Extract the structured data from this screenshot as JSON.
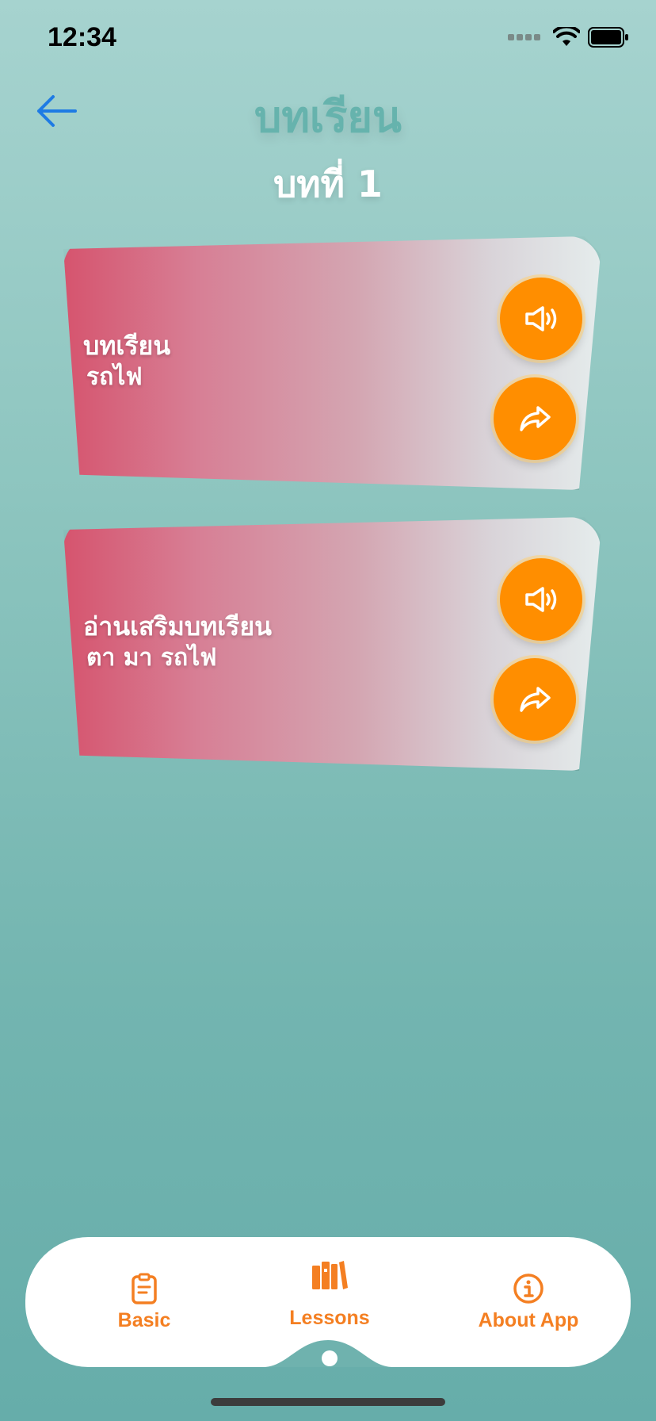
{
  "status_bar": {
    "time": "12:34"
  },
  "header": {
    "title": "บทเรียน",
    "subtitle": "บทที่ 1",
    "back_icon": "arrow-left-icon"
  },
  "cards": [
    {
      "line1": "บทเรียน",
      "line2": "รถไฟ",
      "buttons": [
        "speaker-icon",
        "share-arrow-icon"
      ]
    },
    {
      "line1": "อ่านเสริมบทเรียน",
      "line2": "ตา มา รถไฟ",
      "buttons": [
        "speaker-icon",
        "share-arrow-icon"
      ]
    }
  ],
  "tabbar": {
    "tabs": [
      {
        "label": "Basic",
        "icon": "clipboard-icon"
      },
      {
        "label": "Lessons",
        "icon": "books-icon",
        "selected": true
      },
      {
        "label": "About App",
        "icon": "info-icon"
      }
    ]
  },
  "colors": {
    "accent": "#F47F22",
    "button_orange": "#FF8E00",
    "title_teal": "#66B3AD",
    "back_blue": "#1E7BE4"
  }
}
